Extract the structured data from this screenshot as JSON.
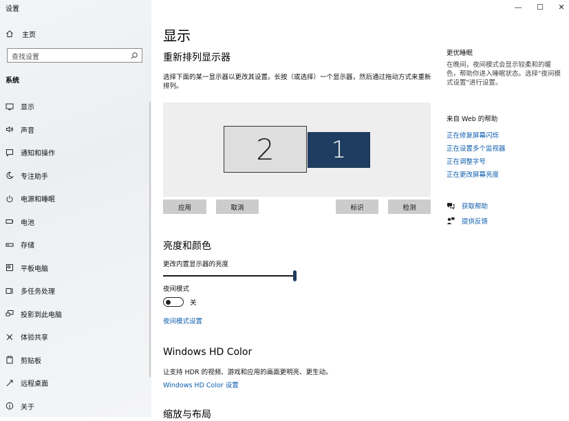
{
  "app": {
    "title": "设置"
  },
  "window": {
    "minimize": "—",
    "maximize": "☐",
    "close": "✕"
  },
  "sidebar": {
    "home_label": "主页",
    "search_placeholder": "查找设置",
    "section": "系统",
    "items": [
      {
        "label": "显示",
        "icon": "monitor-icon"
      },
      {
        "label": "声音",
        "icon": "speaker-icon"
      },
      {
        "label": "通知和操作",
        "icon": "notification-icon"
      },
      {
        "label": "专注助手",
        "icon": "moon-icon"
      },
      {
        "label": "电源和睡眠",
        "icon": "power-icon"
      },
      {
        "label": "电池",
        "icon": "battery-icon"
      },
      {
        "label": "存储",
        "icon": "storage-icon"
      },
      {
        "label": "平板电脑",
        "icon": "tablet-icon"
      },
      {
        "label": "多任务处理",
        "icon": "multitask-icon"
      },
      {
        "label": "投影到此电脑",
        "icon": "project-icon"
      },
      {
        "label": "体验共享",
        "icon": "share-icon"
      },
      {
        "label": "剪贴板",
        "icon": "clipboard-icon"
      },
      {
        "label": "远程桌面",
        "icon": "remote-icon"
      },
      {
        "label": "关于",
        "icon": "info-icon"
      }
    ]
  },
  "main": {
    "title": "显示",
    "arrange": {
      "heading": "重新排列显示器",
      "desc": "选择下面的某一显示器以更改其设置。长按（或选择）一个显示器，然后通过拖动方式来重新排列。",
      "monitor_2": "2",
      "monitor_1": "1",
      "apply": "应用",
      "cancel": "取消",
      "identify": "标识",
      "detect": "检测"
    },
    "brightness": {
      "heading": "亮度和颜色",
      "slider_label": "更改内置显示器的亮度",
      "slider_value_percent": 100,
      "night_label": "夜间模式",
      "night_state": "关",
      "night_settings_link": "夜间模式设置"
    },
    "hdr": {
      "heading": "Windows HD Color",
      "desc": "让支持 HDR 的视频、游戏和应用的画面更明亮、更生动。",
      "link": "Windows HD Color 设置"
    },
    "scale": {
      "heading": "缩放与布局"
    }
  },
  "right": {
    "sleep_title": "更优睡眠",
    "sleep_text": "在晚间，夜间模式会显示较柔和的暖色，帮助你进入睡眠状态。选择\"夜间模式设置\"进行设置。",
    "web_help_title": "来自 Web 的帮助",
    "links": [
      "正在修复屏幕闪烁",
      "正在设置多个监视器",
      "正在调整字号",
      "正在更改屏幕亮度"
    ],
    "get_help": "获取帮助",
    "feedback": "提供反馈"
  }
}
